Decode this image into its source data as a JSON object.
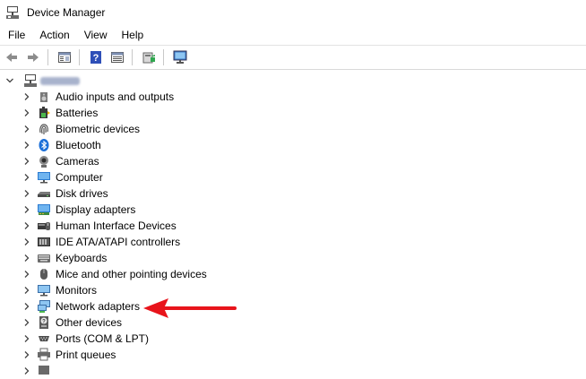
{
  "window": {
    "title": "Device Manager"
  },
  "menu": [
    "File",
    "Action",
    "View",
    "Help"
  ],
  "toolbar": {
    "buttons": [
      "back-icon",
      "forward-icon",
      "properties-icon",
      "help-icon",
      "view-icon",
      "update-driver-icon",
      "scan-hardware-icon"
    ]
  },
  "tree": {
    "root": {
      "label_redacted": true,
      "expanded": true
    },
    "items": [
      {
        "label": "Audio inputs and outputs",
        "icon": "speaker-icon"
      },
      {
        "label": "Batteries",
        "icon": "battery-icon"
      },
      {
        "label": "Biometric devices",
        "icon": "fingerprint-icon"
      },
      {
        "label": "Bluetooth",
        "icon": "bluetooth-icon"
      },
      {
        "label": "Cameras",
        "icon": "camera-icon"
      },
      {
        "label": "Computer",
        "icon": "computer-icon"
      },
      {
        "label": "Disk drives",
        "icon": "disk-drive-icon"
      },
      {
        "label": "Display adapters",
        "icon": "display-adapter-icon"
      },
      {
        "label": "Human Interface Devices",
        "icon": "hid-icon"
      },
      {
        "label": "IDE ATA/ATAPI controllers",
        "icon": "ide-controller-icon"
      },
      {
        "label": "Keyboards",
        "icon": "keyboard-icon"
      },
      {
        "label": "Mice and other pointing devices",
        "icon": "mouse-icon"
      },
      {
        "label": "Monitors",
        "icon": "monitor-icon"
      },
      {
        "label": "Network adapters",
        "icon": "network-adapter-icon"
      },
      {
        "label": "Other devices",
        "icon": "other-devices-icon"
      },
      {
        "label": "Ports (COM & LPT)",
        "icon": "port-icon"
      },
      {
        "label": "Print queues",
        "icon": "printer-icon"
      }
    ]
  },
  "annotation": {
    "pointer": "red-arrow",
    "color": "#e8141b"
  }
}
